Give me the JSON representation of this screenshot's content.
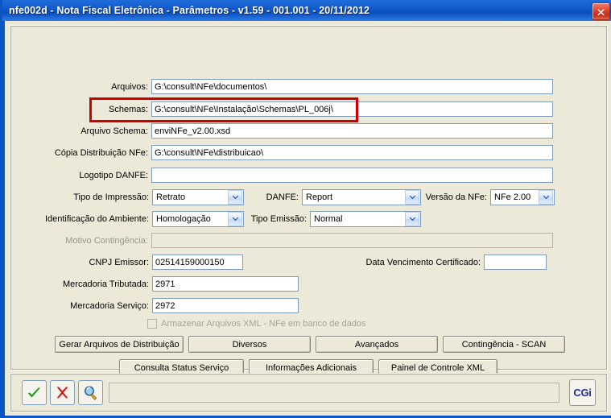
{
  "window": {
    "title": "nfe002d - Nota Fiscal Eletrônica - Parâmetros - v1.59 - 001.001 - 20/11/2012",
    "close_icon": "close-icon",
    "accent_color": "#0a55c4",
    "background_color": "#ece9d8",
    "highlight_color": "#cc0000"
  },
  "form": {
    "text_fields": [
      {
        "label": "Arquivos:",
        "value": "G:\\consult\\NFe\\documentos\\",
        "placeholder": "",
        "disabled": false
      },
      {
        "label": "Schemas:",
        "value": "G:\\consult\\NFe\\Instalação\\Schemas\\PL_006j\\",
        "placeholder": "",
        "disabled": false
      },
      {
        "label": "Arquivo Schema:",
        "value": "enviNFe_v2.00.xsd",
        "placeholder": "",
        "disabled": false
      },
      {
        "label": "Cópia Distribuição NFe:",
        "value": "G:\\consult\\NFe\\distribuicao\\",
        "placeholder": "",
        "disabled": false
      },
      {
        "label": "Logotipo DANFE:",
        "value": "",
        "placeholder": "",
        "disabled": false
      }
    ],
    "selects": [
      {
        "label": "Tipo de Impressão:",
        "value": "Retrato"
      },
      {
        "label": "DANFE:",
        "value": "Report"
      },
      {
        "label": "Versão da NFe:",
        "value": "NFe 2.00"
      },
      {
        "label": "Identificação do Ambiente:",
        "value": "Homologação"
      },
      {
        "label": "Tipo Emissão:",
        "value": "Normal"
      }
    ],
    "motivo": {
      "label": "Motivo Contingência:",
      "value": "",
      "disabled": true
    },
    "cnpj": {
      "label": "CNPJ Emissor:",
      "value": "02514159000150"
    },
    "data_venc": {
      "label": "Data Vencimento Certificado:",
      "value": ""
    },
    "merc_trib": {
      "label": "Mercadoria Tributada:",
      "value": "2971"
    },
    "merc_serv": {
      "label": "Mercadoria Serviço:",
      "value": "2972"
    },
    "checkbox": {
      "label": "Armazenar Arquivos XML - NFe em banco de dados",
      "checked": false,
      "disabled": true
    }
  },
  "buttons": {
    "row1": [
      "Gerar Arquivos de Distribuição",
      "Diversos",
      "Avançados",
      "Contingência - SCAN"
    ],
    "row2": [
      "Consulta Status Serviço",
      "Informações Adicionais",
      "Painel de Controle XML"
    ]
  },
  "toolbar": {
    "confirm_icon": "check-icon",
    "cancel_icon": "x-icon",
    "search_icon": "magnifier-icon",
    "status_value": "",
    "logo_text": "CGi"
  }
}
